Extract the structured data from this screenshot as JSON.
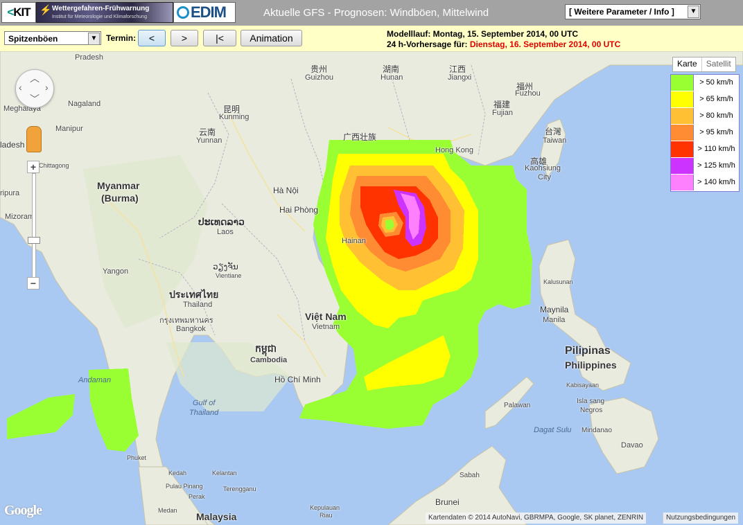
{
  "header": {
    "kit_logo_text": "KIT",
    "banner_title": "Wettergefahren-Frühwarnung",
    "banner_subtitle": "Institut für Meteorologie und Klimaforschung",
    "cedim_logo_text": "EDIM",
    "title": "Aktuelle GFS - Prognosen: Windböen, Mittelwind",
    "param_select_value": "[ Weitere Parameter / Info ]"
  },
  "toolbar": {
    "variable_select_value": "Spitzenböen",
    "termin_label": "Termin:",
    "buttons": {
      "prev": "<",
      "next": ">",
      "first": "|<",
      "animation": "Animation"
    },
    "model_run": "Modelllauf: Montag, 15. September 2014, 00 UTC",
    "forecast_prefix": "24 h-Vorhersage für: ",
    "forecast_date": "Dienstag, 16. September 2014, 00 UTC"
  },
  "map": {
    "maptype": {
      "map": "Karte",
      "satellite": "Satellit"
    },
    "legend": [
      {
        "label": "> 50 km/h",
        "color": "#99ff33"
      },
      {
        "label": "> 65 km/h",
        "color": "#ffff00"
      },
      {
        "label": "> 80 km/h",
        "color": "#ffc033"
      },
      {
        "label": "> 95 km/h",
        "color": "#ff8c33"
      },
      {
        "label": "> 110 km/h",
        "color": "#ff3300"
      },
      {
        "label": "> 125 km/h",
        "color": "#cc33ff"
      },
      {
        "label": "> 140 km/h",
        "color": "#ff80ff"
      }
    ],
    "labels": {
      "pradesh": "Pradesh",
      "meghalaya": "Meghalaya",
      "nagaland": "Nagaland",
      "manipur": "Manipur",
      "bangladesh": "ladesh",
      "chittagong": "Chittagong",
      "tripura": "ripura",
      "mizoram": "Mizoram",
      "myanmar": "Myanmar",
      "burma": "(Burma)",
      "yangon": "Yangon",
      "yunnan_cn": "云南",
      "yunnan": "Yunnan",
      "kunming_cn": "昆明",
      "kunming": "Kunming",
      "guizhou_cn": "贵州",
      "guizhou": "Guizhou",
      "hunan_cn": "湖南",
      "hunan": "Hunan",
      "jiangxi_cn": "江西",
      "jiangxi": "Jiangxi",
      "fuzhou_cn": "福州",
      "fuzhou": "Fuzhou",
      "fujian_cn": "福建",
      "fujian": "Fujian",
      "guangxi": "广西壮族",
      "hongkong": "Hong Kong",
      "taiwan_cn": "台灣",
      "taiwan": "Taiwan",
      "kaohsiung_cn": "高雄",
      "kaohsiung": "Kaohsiung",
      "city": "City",
      "hanoi": "Hà Nội",
      "haiphong": "Hai Phòng",
      "laos_local": "ປະເທດລາວ",
      "laos": "Laos",
      "vientiane_local": "ວຽງຈັນ",
      "vientiane": "Vientiane",
      "hainan": "Hainan",
      "thailand_local": "ประเทศไทย",
      "thailand": "Thailand",
      "bangkok_local": "กรุงเทพมหานคร",
      "bangkok": "Bangkok",
      "vietnam": "Việt Nam",
      "vietnam_en": "Vietnam",
      "cambodia_local": "កម្ពុជា",
      "cambodia": "Cambodia",
      "hochiminh": "Hồ Chí Minh",
      "gulf": "Gulf of",
      "thailand_gulf": "Thailand",
      "andaman": "Andaman",
      "kalusunan": "Kalusunan",
      "maynila": "Maynila",
      "manila": "Manila",
      "pilipinas": "Pilipinas",
      "philippines": "Philippines",
      "kabisayaan": "Kabisayaan",
      "palawan": "Palawan",
      "islasang": "Isla sang",
      "negros": "Negros",
      "dagatsulu": "Dagat Sulu",
      "mindanao": "Mindanao",
      "davao": "Davao",
      "sabah": "Sabah",
      "brunei": "Brunei",
      "kepulauan": "Kepulauan",
      "riau": "Riau",
      "malaysia": "Malaysia",
      "phuket": "Phuket",
      "kedah": "Kedah",
      "pulaupinang": "Pulau Pinang",
      "perak": "Perak",
      "kelantan": "Kelantan",
      "terengganu": "Terengganu",
      "medan": "Medan"
    },
    "google_logo": "Google",
    "attribution": "Kartendaten © 2014 AutoNavi, GBRMPA, Google, SK planet, ZENRIN",
    "terms": "Nutzungsbedingungen"
  }
}
